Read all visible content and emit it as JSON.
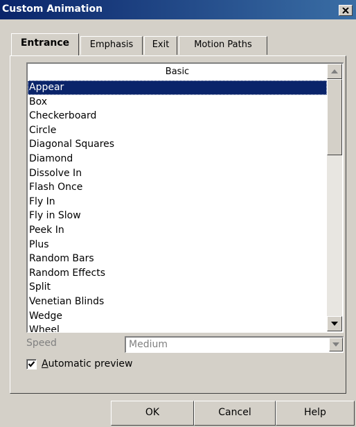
{
  "window": {
    "title": "Custom Animation",
    "close_icon": "close-icon"
  },
  "tabs": [
    {
      "label": "Entrance",
      "active": true
    },
    {
      "label": "Emphasis",
      "active": false
    },
    {
      "label": "Exit",
      "active": false
    },
    {
      "label": "Motion Paths",
      "active": false
    }
  ],
  "effects_list": {
    "header": "Basic",
    "selected": "Appear",
    "items": [
      "Appear",
      "Box",
      "Checkerboard",
      "Circle",
      "Diagonal Squares",
      "Diamond",
      "Dissolve In",
      "Flash Once",
      "Fly In",
      "Fly in Slow",
      "Peek In",
      "Plus",
      "Random Bars",
      "Random Effects",
      "Split",
      "Venetian Blinds",
      "Wedge",
      "Wheel"
    ]
  },
  "speed": {
    "label": "Speed",
    "value": "Medium",
    "enabled": false
  },
  "automatic_preview": {
    "label": "Automatic preview",
    "checked": true
  },
  "buttons": {
    "ok": "OK",
    "cancel": "Cancel",
    "help": "Help"
  }
}
